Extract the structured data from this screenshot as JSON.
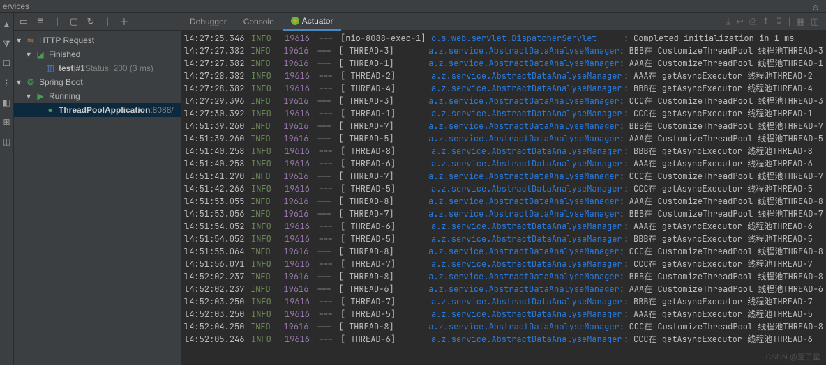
{
  "window": {
    "title": "ervices"
  },
  "tabs": {
    "debugger": "Debugger",
    "console": "Console",
    "actuator": "Actuator"
  },
  "tree": {
    "httpRequest": "HTTP Request",
    "finished": "Finished",
    "test": "test",
    "testSep": " | ",
    "testHash": "#1",
    "testStatus": " Status: 200 (3 ms)",
    "springBoot": "Spring Boot",
    "running": "Running",
    "app": "ThreadPoolApplication ",
    "appPort": ":8088/"
  },
  "watermark": "CSDN @至子星",
  "logs": [
    {
      "time": "l4:27:25.346",
      "level": "INFO",
      "pid": "19616",
      "dash": "---",
      "thread": "[nio-8088-exec-1]",
      "logger": "o.s.web.servlet.DispatcherServlet",
      "msg": "Completed initialization in 1 ms"
    },
    {
      "time": "l4:27:27.382",
      "level": "INFO",
      "pid": "19616",
      "dash": "---",
      "thread": "[       THREAD-3]",
      "logger": "a.z.service.AbstractDataAnalyseManager",
      "msg": "BBB在 CustomizeThreadPool 线程池THREAD-3"
    },
    {
      "time": "l4:27:27.382",
      "level": "INFO",
      "pid": "19616",
      "dash": "---",
      "thread": "[       THREAD-1]",
      "logger": "a.z.service.AbstractDataAnalyseManager",
      "msg": "AAA在 CustomizeThreadPool 线程池THREAD-1"
    },
    {
      "time": "l4:27:28.382",
      "level": "INFO",
      "pid": "19616",
      "dash": "---",
      "thread": "[       THREAD-2]",
      "logger": "a.z.service.AbstractDataAnalyseManager",
      "msg": "AAA在 getAsyncExecutor 线程池THREAD-2"
    },
    {
      "time": "l4:27:28.382",
      "level": "INFO",
      "pid": "19616",
      "dash": "---",
      "thread": "[       THREAD-4]",
      "logger": "a.z.service.AbstractDataAnalyseManager",
      "msg": "BBB在 getAsyncExecutor 线程池THREAD-4"
    },
    {
      "time": "l4:27:29.396",
      "level": "INFO",
      "pid": "19616",
      "dash": "---",
      "thread": "[       THREAD-3]",
      "logger": "a.z.service.AbstractDataAnalyseManager",
      "msg": "CCC在 CustomizeThreadPool 线程池THREAD-3"
    },
    {
      "time": "l4:27:30.392",
      "level": "INFO",
      "pid": "19616",
      "dash": "---",
      "thread": "[       THREAD-1]",
      "logger": "a.z.service.AbstractDataAnalyseManager",
      "msg": "CCC在 getAsyncExecutor 线程池THREAD-1"
    },
    {
      "time": "l4:51:39.260",
      "level": "INFO",
      "pid": "19616",
      "dash": "---",
      "thread": "[       THREAD-7]",
      "logger": "a.z.service.AbstractDataAnalyseManager",
      "msg": "BBB在 CustomizeThreadPool 线程池THREAD-7"
    },
    {
      "time": "l4:51:39.260",
      "level": "INFO",
      "pid": "19616",
      "dash": "---",
      "thread": "[       THREAD-5]",
      "logger": "a.z.service.AbstractDataAnalyseManager",
      "msg": "AAA在 CustomizeThreadPool 线程池THREAD-5"
    },
    {
      "time": "l4:51:40.258",
      "level": "INFO",
      "pid": "19616",
      "dash": "---",
      "thread": "[       THREAD-8]",
      "logger": "a.z.service.AbstractDataAnalyseManager",
      "msg": "BBB在 getAsyncExecutor 线程池THREAD-8"
    },
    {
      "time": "l4:51:40.258",
      "level": "INFO",
      "pid": "19616",
      "dash": "---",
      "thread": "[       THREAD-6]",
      "logger": "a.z.service.AbstractDataAnalyseManager",
      "msg": "AAA在 getAsyncExecutor 线程池THREAD-6"
    },
    {
      "time": "l4:51:41.270",
      "level": "INFO",
      "pid": "19616",
      "dash": "---",
      "thread": "[       THREAD-7]",
      "logger": "a.z.service.AbstractDataAnalyseManager",
      "msg": "CCC在 CustomizeThreadPool 线程池THREAD-7"
    },
    {
      "time": "l4:51:42.266",
      "level": "INFO",
      "pid": "19616",
      "dash": "---",
      "thread": "[       THREAD-5]",
      "logger": "a.z.service.AbstractDataAnalyseManager",
      "msg": "CCC在 getAsyncExecutor 线程池THREAD-5"
    },
    {
      "time": "l4:51:53.055",
      "level": "INFO",
      "pid": "19616",
      "dash": "---",
      "thread": "[       THREAD-8]",
      "logger": "a.z.service.AbstractDataAnalyseManager",
      "msg": "AAA在 CustomizeThreadPool 线程池THREAD-8"
    },
    {
      "time": "l4:51:53.056",
      "level": "INFO",
      "pid": "19616",
      "dash": "---",
      "thread": "[       THREAD-7]",
      "logger": "a.z.service.AbstractDataAnalyseManager",
      "msg": "BBB在 CustomizeThreadPool 线程池THREAD-7"
    },
    {
      "time": "l4:51:54.052",
      "level": "INFO",
      "pid": "19616",
      "dash": "---",
      "thread": "[       THREAD-6]",
      "logger": "a.z.service.AbstractDataAnalyseManager",
      "msg": "AAA在 getAsyncExecutor 线程池THREAD-6"
    },
    {
      "time": "l4:51:54.052",
      "level": "INFO",
      "pid": "19616",
      "dash": "---",
      "thread": "[       THREAD-5]",
      "logger": "a.z.service.AbstractDataAnalyseManager",
      "msg": "BBB在 getAsyncExecutor 线程池THREAD-5"
    },
    {
      "time": "l4:51:55.064",
      "level": "INFO",
      "pid": "19616",
      "dash": "---",
      "thread": "[       THREAD-8]",
      "logger": "a.z.service.AbstractDataAnalyseManager",
      "msg": "CCC在 CustomizeThreadPool 线程池THREAD-8"
    },
    {
      "time": "l4:51:56.071",
      "level": "INFO",
      "pid": "19616",
      "dash": "---",
      "thread": "[       THREAD-7]",
      "logger": "a.z.service.AbstractDataAnalyseManager",
      "msg": "CCC在 getAsyncExecutor 线程池THREAD-7"
    },
    {
      "time": "l4:52:02.237",
      "level": "INFO",
      "pid": "19616",
      "dash": "---",
      "thread": "[       THREAD-8]",
      "logger": "a.z.service.AbstractDataAnalyseManager",
      "msg": "BBB在 CustomizeThreadPool 线程池THREAD-8"
    },
    {
      "time": "l4:52:02.237",
      "level": "INFO",
      "pid": "19616",
      "dash": "---",
      "thread": "[       THREAD-6]",
      "logger": "a.z.service.AbstractDataAnalyseManager",
      "msg": "AAA在 CustomizeThreadPool 线程池THREAD-6"
    },
    {
      "time": "l4:52:03.250",
      "level": "INFO",
      "pid": "19616",
      "dash": "---",
      "thread": "[       THREAD-7]",
      "logger": "a.z.service.AbstractDataAnalyseManager",
      "msg": "BBB在 getAsyncExecutor 线程池THREAD-7"
    },
    {
      "time": "l4:52:03.250",
      "level": "INFO",
      "pid": "19616",
      "dash": "---",
      "thread": "[       THREAD-5]",
      "logger": "a.z.service.AbstractDataAnalyseManager",
      "msg": "AAA在 getAsyncExecutor 线程池THREAD-5"
    },
    {
      "time": "l4:52:04.250",
      "level": "INFO",
      "pid": "19616",
      "dash": "---",
      "thread": "[       THREAD-8]",
      "logger": "a.z.service.AbstractDataAnalyseManager",
      "msg": "CCC在 CustomizeThreadPool 线程池THREAD-8"
    },
    {
      "time": "l4:52:05.246",
      "level": "INFO",
      "pid": "19616",
      "dash": "---",
      "thread": "[       THREAD-6]",
      "logger": "a.z.service.AbstractDataAnalyseManager",
      "msg": "CCC在 getAsyncExecutor 线程池THREAD-6"
    }
  ]
}
